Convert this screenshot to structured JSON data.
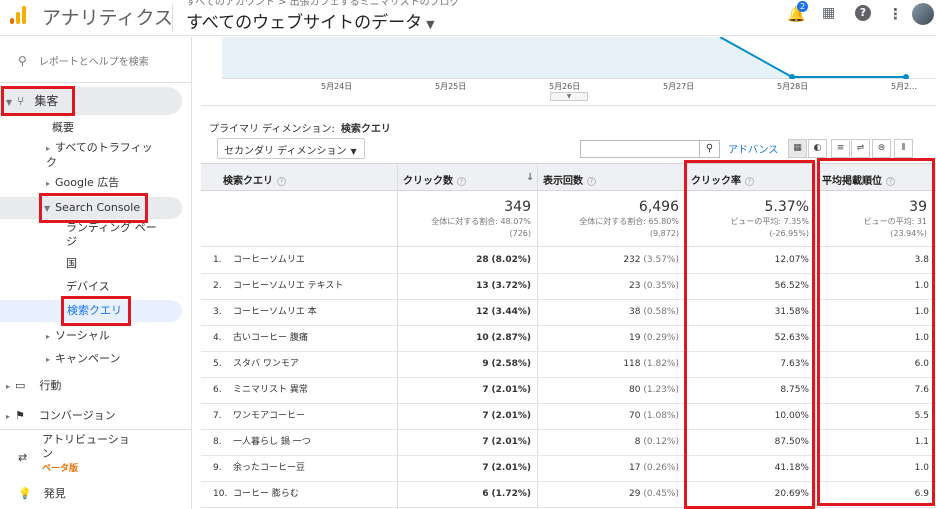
{
  "header": {
    "app_name": "アナリティクス",
    "breadcrumb": "すべてのアカウント > 出張カフェするミニマリストのブログ",
    "view_name": "すべてのウェブサイトのデータ",
    "notif_count": "2"
  },
  "sidebar": {
    "search_placeholder": "レポートとヘルプを検索",
    "items": [
      "集客",
      "概要",
      "すべてのトラフィック",
      "Google 広告",
      "Search Console",
      "ランディング ページ",
      "国",
      "デバイス",
      "検索クエリ",
      "ソーシャル",
      "キャンペーン",
      "行動",
      "コンバージョン",
      "アトリビューション",
      "ベータ版",
      "発見"
    ]
  },
  "chart": {
    "dates": [
      "5月24日",
      "5月25日",
      "5月26日",
      "5月27日",
      "5月28日",
      "5月2…"
    ]
  },
  "report": {
    "primary_dimension_label": "プライマリ ディメンション:",
    "primary_dimension_value": "検索クエリ",
    "secondary_dimension": "セカンダリ ディメンション",
    "advanced": "アドバンス"
  },
  "table": {
    "headers": [
      "検索クエリ",
      "クリック数",
      "表示回数",
      "クリック率",
      "平均掲載順位"
    ],
    "totals": [
      {
        "big": "349",
        "l1": "全体に対する割合: 48.07%",
        "l2": "(726)"
      },
      {
        "big": "6,496",
        "l1": "全体に対する割合: 65.80%",
        "l2": "(9,872)"
      },
      {
        "big": "5.37%",
        "l1": "ビューの平均: 7.35%",
        "l2": "(-26.95%)"
      },
      {
        "big": "39",
        "l1": "ビューの平均: 31",
        "l2": "(23.94%)"
      }
    ],
    "rows": [
      {
        "n": "1.",
        "q": "コーヒーソムリエ",
        "c": "28",
        "cp": "(8.02%)",
        "i": "232",
        "ip": "(3.57%)",
        "ctr": "12.07%",
        "pos": "3.8"
      },
      {
        "n": "2.",
        "q": "コーヒーソムリエ テキスト",
        "c": "13",
        "cp": "(3.72%)",
        "i": "23",
        "ip": "(0.35%)",
        "ctr": "56.52%",
        "pos": "1.0"
      },
      {
        "n": "3.",
        "q": "コーヒーソムリエ 本",
        "c": "12",
        "cp": "(3.44%)",
        "i": "38",
        "ip": "(0.58%)",
        "ctr": "31.58%",
        "pos": "1.0"
      },
      {
        "n": "4.",
        "q": "古いコーヒー 腹痛",
        "c": "10",
        "cp": "(2.87%)",
        "i": "19",
        "ip": "(0.29%)",
        "ctr": "52.63%",
        "pos": "1.0"
      },
      {
        "n": "5.",
        "q": "スタバ ワンモア",
        "c": "9",
        "cp": "(2.58%)",
        "i": "118",
        "ip": "(1.82%)",
        "ctr": "7.63%",
        "pos": "6.0"
      },
      {
        "n": "6.",
        "q": "ミニマリスト 異常",
        "c": "7",
        "cp": "(2.01%)",
        "i": "80",
        "ip": "(1.23%)",
        "ctr": "8.75%",
        "pos": "7.6"
      },
      {
        "n": "7.",
        "q": "ワンモアコーヒー",
        "c": "7",
        "cp": "(2.01%)",
        "i": "70",
        "ip": "(1.08%)",
        "ctr": "10.00%",
        "pos": "5.5"
      },
      {
        "n": "8.",
        "q": "一人暮らし 鍋 一つ",
        "c": "7",
        "cp": "(2.01%)",
        "i": "8",
        "ip": "(0.12%)",
        "ctr": "87.50%",
        "pos": "1.1"
      },
      {
        "n": "9.",
        "q": "余ったコーヒー豆",
        "c": "7",
        "cp": "(2.01%)",
        "i": "17",
        "ip": "(0.26%)",
        "ctr": "41.18%",
        "pos": "1.0"
      },
      {
        "n": "10.",
        "q": "コーヒー 膨らむ",
        "c": "6",
        "cp": "(1.72%)",
        "i": "29",
        "ip": "(0.45%)",
        "ctr": "20.69%",
        "pos": "6.9"
      }
    ]
  },
  "colors": {
    "highlight_red": "#e0171e",
    "link_blue": "#1a73e8",
    "chart_line": "#058dc7"
  }
}
